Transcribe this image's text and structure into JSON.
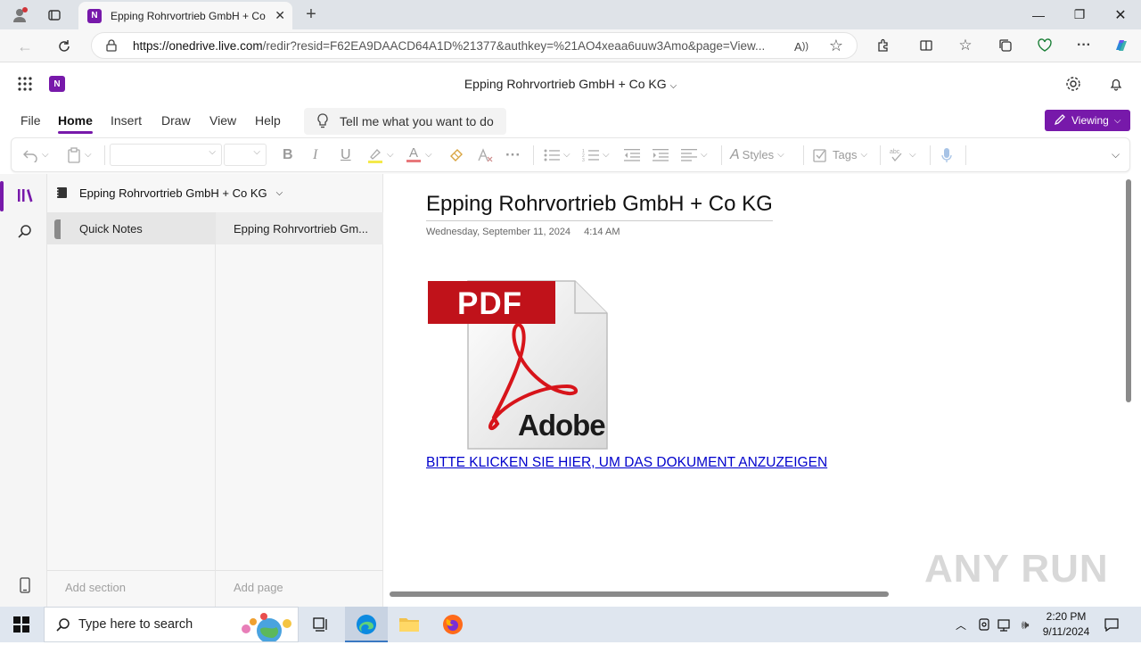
{
  "browser": {
    "tab_title": "Epping Rohrvortrieb GmbH + Co",
    "url_host": "https://onedrive.live.com",
    "url_rest": "/redir?resid=F62EA9DAACD64A1D%21377&authkey=%21AO4xeaa6uuw3Amo&page=View..."
  },
  "app": {
    "notebook_title": "Epping Rohrvortrieb GmbH + Co KG",
    "menu": [
      "File",
      "Home",
      "Insert",
      "Draw",
      "View",
      "Help"
    ],
    "tell_me": "Tell me what you want to do",
    "viewing_label": "Viewing"
  },
  "ribbon": {
    "styles_label": "Styles",
    "tags_label": "Tags"
  },
  "nav": {
    "notebook_name": "Epping Rohrvortrieb GmbH + Co KG",
    "section": "Quick Notes",
    "page": "Epping Rohrvortrieb Gm...",
    "add_section": "Add section",
    "add_page": "Add page"
  },
  "page": {
    "title": "Epping Rohrvortrieb GmbH + Co KG",
    "date": "Wednesday, September 11, 2024",
    "time": "4:14 AM",
    "pdf_badge": "PDF",
    "adobe_text": "Adobe",
    "link": "BITTE KLICKEN SIE HIER, UM DAS DOKUMENT ANZUZEIGEN"
  },
  "watermark": "ANY RUN",
  "taskbar": {
    "search_placeholder": "Type here to search",
    "time": "2:20 PM",
    "date": "9/11/2024"
  },
  "colors": {
    "brand": "#7719aa",
    "link": "#0000cc",
    "pdf_red": "#c0121a"
  }
}
